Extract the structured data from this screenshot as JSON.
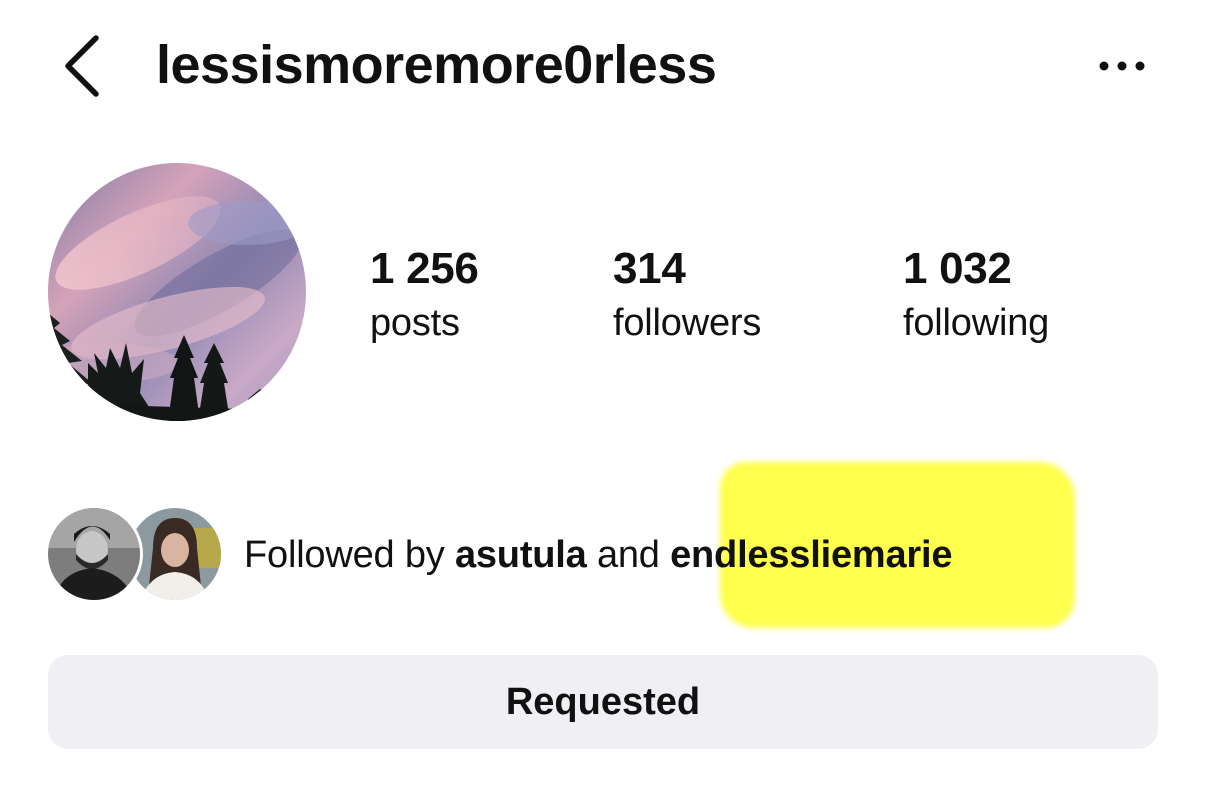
{
  "header": {
    "username": "lessismoremore0rless",
    "back_icon": "chevron-left-icon",
    "more_icon": "more-horizontal-icon"
  },
  "profile": {
    "avatar_icon": "sunset-sky-photo"
  },
  "stats": {
    "posts": {
      "value": "1 256",
      "label": "posts"
    },
    "followers": {
      "value": "314",
      "label": "followers"
    },
    "following": {
      "value": "1 032",
      "label": "following"
    }
  },
  "mutual": {
    "prefix": "Followed by",
    "user1": "asutula",
    "conjunction": "and",
    "user2": "endlessliemarie"
  },
  "actions": {
    "requested_label": "Requested"
  },
  "colors": {
    "highlight": "#ffff44",
    "button_bg": "#efeff4",
    "text": "#111111"
  }
}
